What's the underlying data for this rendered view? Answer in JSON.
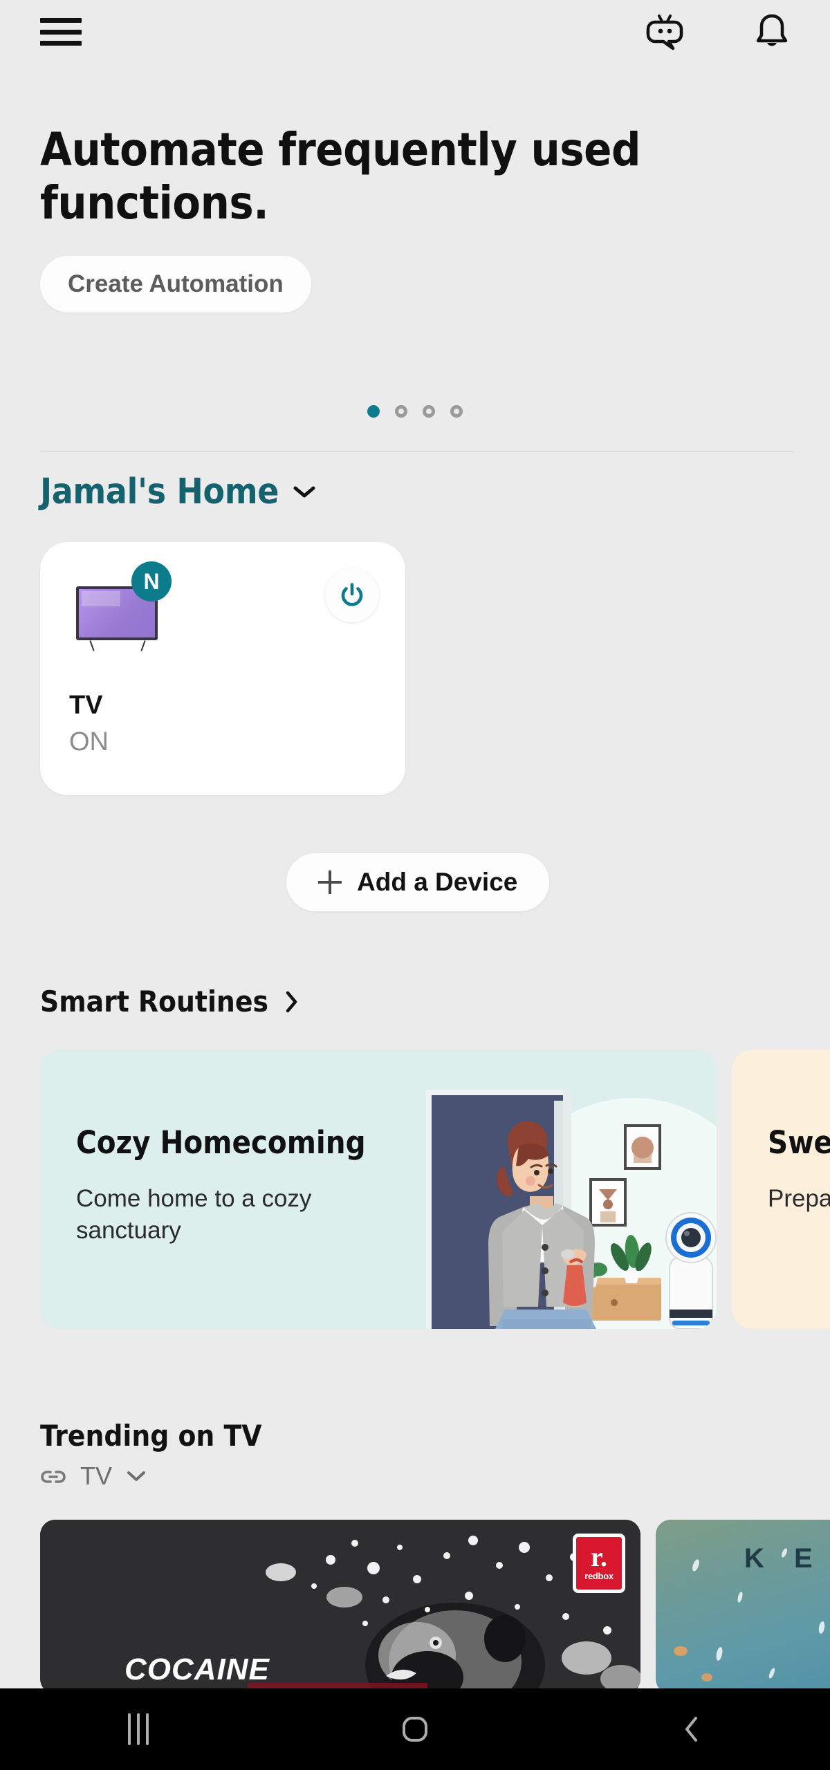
{
  "topbar": {
    "menu_icon": "hamburger-menu-icon",
    "bot_icon": "bixby-bot-icon",
    "bell_icon": "notification-bell-icon"
  },
  "hero": {
    "title": "Automate frequently used functions.",
    "button_label": "Create Automation",
    "dots": {
      "count": 4,
      "active_index": 0,
      "active_color": "#0C7C8C",
      "inactive_color": "#9A9A9A"
    }
  },
  "home": {
    "name": "Jamal's Home",
    "name_color": "#14626E",
    "chevron_icon": "chevron-down-icon"
  },
  "devices": [
    {
      "name": "TV",
      "state": "ON",
      "badge": "N",
      "badge_color": "#0C7C8C",
      "power_icon": "power-icon",
      "power_color": "#0C7C8C",
      "screen_color": "#9B7BD4"
    }
  ],
  "add_device": {
    "label": "Add a Device",
    "plus_icon": "plus-icon"
  },
  "smart_routines": {
    "title": "Smart Routines",
    "chevron_icon": "chevron-right-icon",
    "cards": [
      {
        "title": "Cozy Homecoming",
        "description": "Come home to a cozy sanctuary",
        "bg_color": "#DCEFEC"
      },
      {
        "title": "Sweet Dreams",
        "description": "Prepare for a restful night",
        "bg_color": "#FCEFDC"
      }
    ]
  },
  "trending": {
    "title": "Trending on TV",
    "chevron_icon": "chevron-right-icon",
    "source_icon": "link-icon",
    "source_label": "TV",
    "source_chevron_icon": "chevron-down-icon",
    "items": [
      {
        "title": "COCAINE",
        "provider": "redbox",
        "provider_mark": "r.",
        "bg_color": "#2E2E30"
      },
      {
        "title": "K E A",
        "provider": "",
        "bg_color": "#3E86A8"
      }
    ]
  },
  "navbar": {
    "recents_label": "recents-icon",
    "home_label": "home-icon",
    "back_label": "back-icon"
  }
}
